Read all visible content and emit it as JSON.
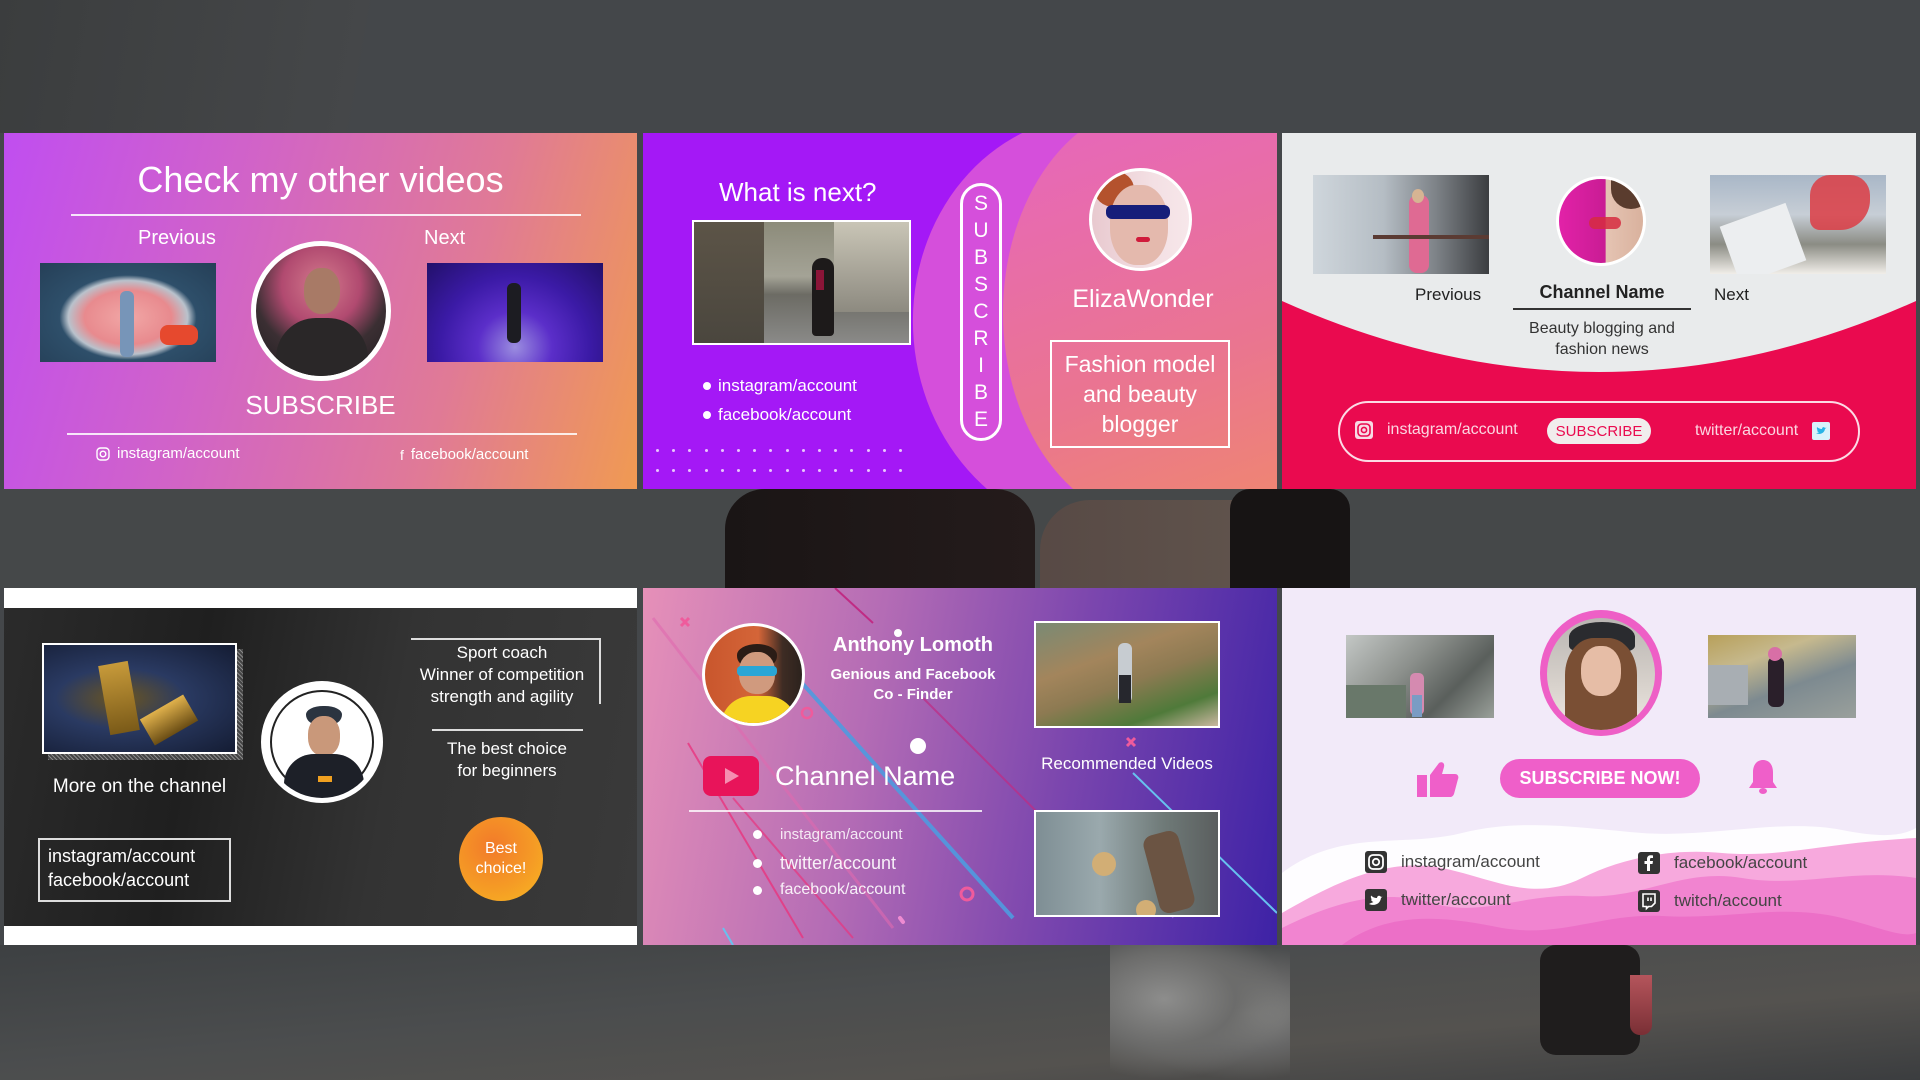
{
  "panels": {
    "p1": {
      "title": "Check my other videos",
      "previous_label": "Previous",
      "next_label": "Next",
      "subscribe_label": "SUBSCRIBE",
      "instagram": "instagram/account",
      "facebook": "facebook/account"
    },
    "p2": {
      "heading": "What is next?",
      "links": [
        "instagram/account",
        "facebook/account"
      ],
      "subscribe_letters": [
        "S",
        "U",
        "B",
        "S",
        "C",
        "R",
        "I",
        "B",
        "E"
      ],
      "name": "ElizaWonder",
      "description_lines": [
        "Fashion model",
        "and beauty",
        "blogger"
      ]
    },
    "p3": {
      "previous_label": "Previous",
      "next_label": "Next",
      "channel_name": "Channel Name",
      "tagline_lines": [
        "Beauty blogging and",
        "fashion news"
      ],
      "instagram": "instagram/account",
      "subscribe_label": "SUBSCRIBE",
      "twitter": "twitter/account",
      "accent": "#ea0a4f"
    },
    "p4": {
      "more_label": "More on the channel",
      "bio_lines": [
        "Sport coach",
        "Winner of competition",
        "strength and agility"
      ],
      "best_lines": [
        "The best choice",
        "for beginners"
      ],
      "links": [
        "instagram/account",
        "facebook/account"
      ],
      "badge_lines": [
        "Best",
        "choice!"
      ],
      "badge_color": "#f5a623"
    },
    "p5": {
      "person_name": "Anthony Lomoth",
      "person_title_lines": [
        "Genious and Facebook",
        "Co - Finder"
      ],
      "channel_name": "Channel Name",
      "links": [
        "instagram/account",
        "twitter/account",
        "facebook/account"
      ],
      "recommended_label": "Recommended Videos",
      "youtube_color": "#e8145a"
    },
    "p6": {
      "subscribe_label": "SUBSCRIBE NOW!",
      "socials": [
        {
          "icon": "instagram-icon",
          "label": "instagram/account"
        },
        {
          "icon": "facebook-icon",
          "label": "facebook/account"
        },
        {
          "icon": "twitter-icon",
          "label": "twitter/account"
        },
        {
          "icon": "twitch-icon",
          "label": "twitch/account"
        }
      ],
      "accent": "#ef5fc9"
    }
  }
}
